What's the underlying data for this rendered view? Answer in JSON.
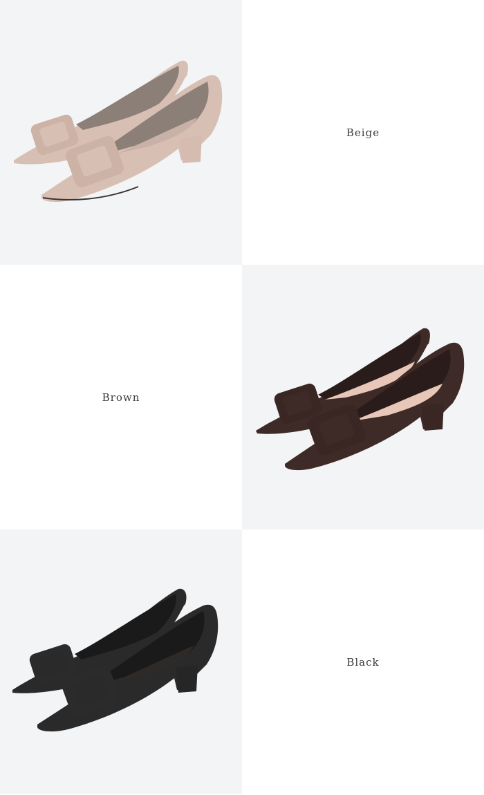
{
  "colors": [
    {
      "name": "Beige",
      "upper": "#d8bfb3",
      "shade": "#bfa497",
      "lining": "#8c7f77",
      "insole": "#c8b2a8",
      "buckle": "#cdb2a6",
      "heel": "#d6bcb0",
      "sole": "#3a3332"
    },
    {
      "name": "Brown",
      "upper": "#3e2a27",
      "shade": "#2c1d1b",
      "lining": "#2a1c1a",
      "insole": "#e8c7b8",
      "buckle": "#3a2724",
      "heel": "#3a2724",
      "sole": "#1e1413"
    },
    {
      "name": "Black",
      "upper": "#2a2a2a",
      "shade": "#1c1c1c",
      "lining": "#1a1a1a",
      "insole": "#2e2a28",
      "buckle": "#2b2b2b",
      "heel": "#262626",
      "sole": "#111111"
    }
  ]
}
